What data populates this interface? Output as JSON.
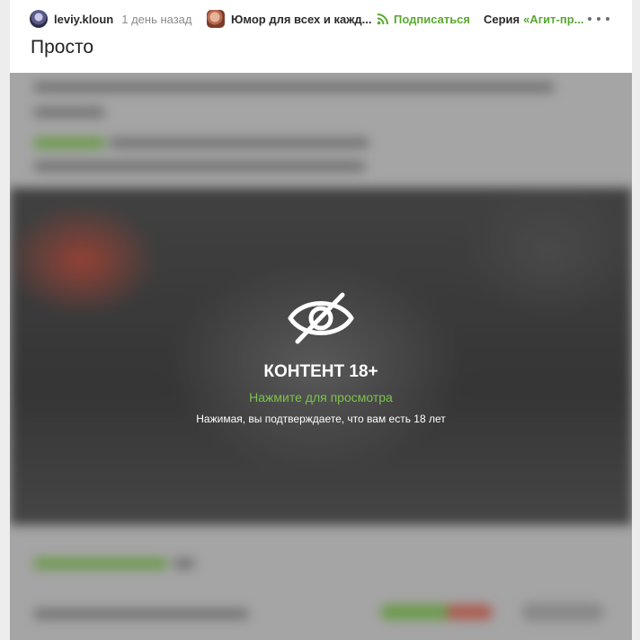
{
  "post": {
    "author": "leviy.kloun",
    "time": "1 день назад",
    "community": "Юмор для всех и кажд...",
    "subscribe_label": "Подписаться",
    "series_prefix": "Серия",
    "series_name": "«Агит-пр...",
    "title": "Просто"
  },
  "nsfw": {
    "title": "КОНТЕНТ 18+",
    "action": "Нажмите для просмотра",
    "note": "Нажимая, вы подтверждаете, что вам есть 18 лет"
  },
  "icons": {
    "more": "more-icon",
    "subscribe": "subscribe-icon",
    "hidden": "eye-off-icon"
  },
  "colors": {
    "accent_green": "#5aa832",
    "overlay_text": "#ffffff"
  }
}
